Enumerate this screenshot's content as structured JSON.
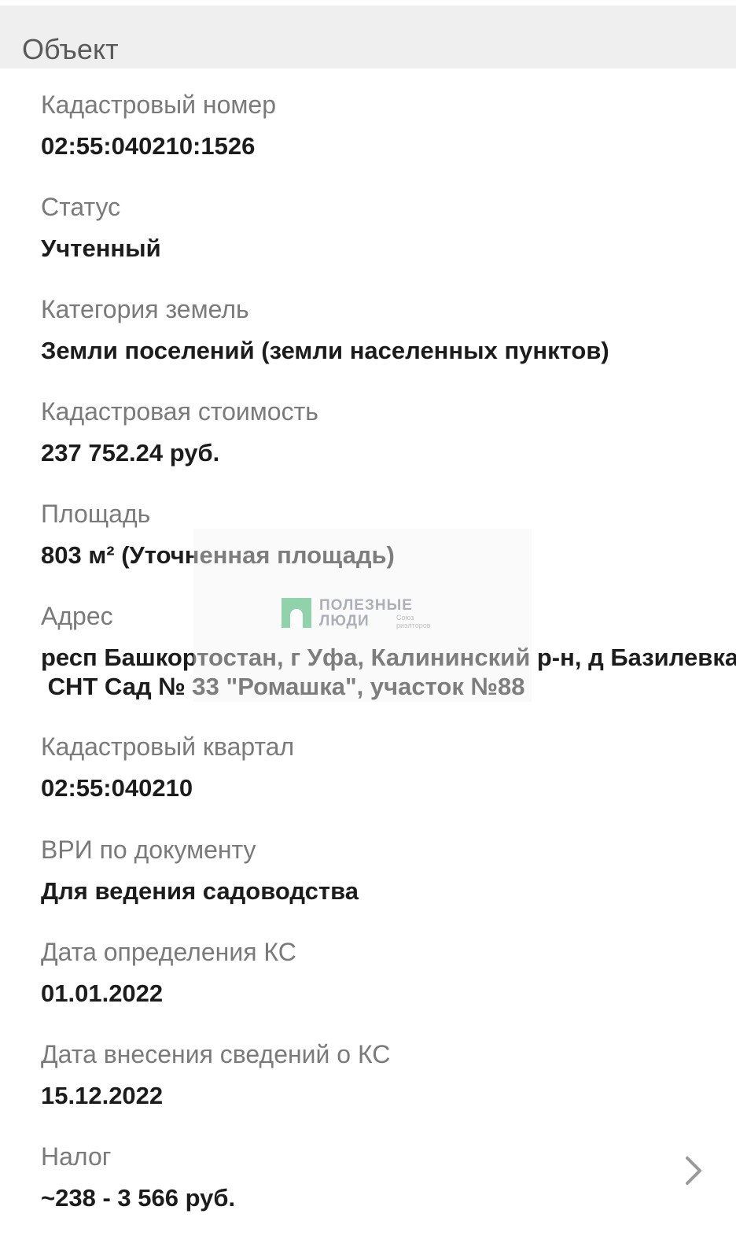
{
  "section": {
    "title": "Объект"
  },
  "fields": [
    {
      "label": "Кадастровый номер",
      "value": "02:55:040210:1526"
    },
    {
      "label": "Статус",
      "value": "Учтенный"
    },
    {
      "label": "Категория земель",
      "value": "Земли поселений (земли населенных пунктов)"
    },
    {
      "label": "Кадастровая стоимость",
      "value": "237 752.24 руб."
    },
    {
      "label": "Площадь",
      "value": "803 м² (Уточненная площадь)"
    },
    {
      "label": "Адрес",
      "value_lines": [
        "респ Башкортостан, г Уфа, Калининский р-н, д Базилевка,",
        " СНТ Сад № 33 \"Ромашка\", участок №88"
      ]
    },
    {
      "label": "Кадастровый квартал",
      "value": "02:55:040210"
    },
    {
      "label": "ВРИ по документу",
      "value": "Для ведения садоводства"
    },
    {
      "label": "Дата определения КС",
      "value": "01.01.2022"
    },
    {
      "label": "Дата внесения сведений о КС",
      "value": "15.12.2022"
    },
    {
      "label": "Налог",
      "value": "~238 - 3 566 руб."
    }
  ],
  "watermark": {
    "line1": "ПОЛЕЗНЫЕ",
    "line2": "ЛЮДИ",
    "sub1": "Союз",
    "sub2": "риэлторов"
  },
  "icons": {
    "tax_arrow": "chevron-right-icon"
  }
}
